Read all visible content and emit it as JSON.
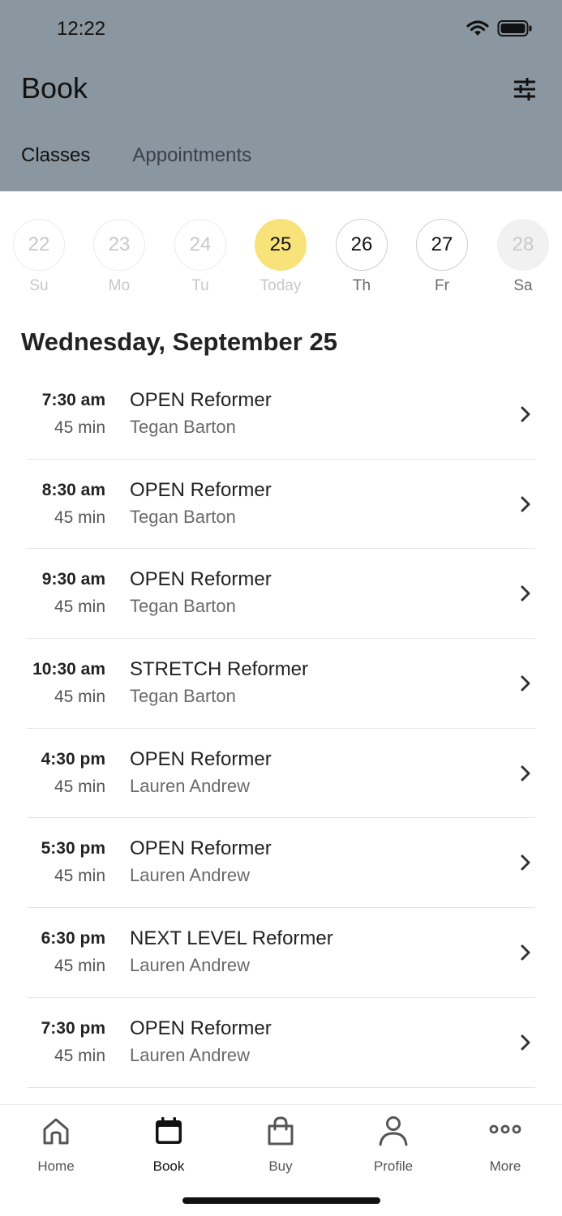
{
  "status_bar": {
    "time": "12:22"
  },
  "header": {
    "title": "Book",
    "tabs": [
      {
        "label": "Classes",
        "active": true
      },
      {
        "label": "Appointments",
        "active": false
      }
    ]
  },
  "days": [
    {
      "num": "22",
      "label": "Su",
      "state": "past"
    },
    {
      "num": "23",
      "label": "Mo",
      "state": "past"
    },
    {
      "num": "24",
      "label": "Tu",
      "state": "past"
    },
    {
      "num": "25",
      "label": "Today",
      "state": "today"
    },
    {
      "num": "26",
      "label": "Th",
      "state": "future"
    },
    {
      "num": "27",
      "label": "Fr",
      "state": "future"
    },
    {
      "num": "28",
      "label": "Sa",
      "state": "sat"
    }
  ],
  "date_heading": "Wednesday, September 25",
  "classes": [
    {
      "time": "7:30 am",
      "duration": "45 min",
      "name": "OPEN Reformer",
      "instructor": "Tegan Barton"
    },
    {
      "time": "8:30 am",
      "duration": "45 min",
      "name": "OPEN Reformer",
      "instructor": "Tegan Barton"
    },
    {
      "time": "9:30 am",
      "duration": "45 min",
      "name": "OPEN Reformer",
      "instructor": "Tegan Barton"
    },
    {
      "time": "10:30 am",
      "duration": "45 min",
      "name": "STRETCH Reformer",
      "instructor": "Tegan Barton"
    },
    {
      "time": "4:30 pm",
      "duration": "45 min",
      "name": "OPEN Reformer",
      "instructor": "Lauren Andrew"
    },
    {
      "time": "5:30 pm",
      "duration": "45 min",
      "name": "OPEN Reformer",
      "instructor": "Lauren Andrew"
    },
    {
      "time": "6:30 pm",
      "duration": "45 min",
      "name": "NEXT LEVEL Reformer",
      "instructor": "Lauren Andrew"
    },
    {
      "time": "7:30 pm",
      "duration": "45 min",
      "name": "OPEN Reformer",
      "instructor": "Lauren Andrew"
    }
  ],
  "tab_bar": [
    {
      "label": "Home",
      "icon": "home-icon",
      "active": false
    },
    {
      "label": "Book",
      "icon": "calendar-icon",
      "active": true
    },
    {
      "label": "Buy",
      "icon": "shopping-bag-icon",
      "active": false
    },
    {
      "label": "Profile",
      "icon": "person-icon",
      "active": false
    },
    {
      "label": "More",
      "icon": "more-dots-icon",
      "active": false
    }
  ],
  "colors": {
    "header_bg": "#8a96a0",
    "today_highlight": "#f8e27a"
  }
}
